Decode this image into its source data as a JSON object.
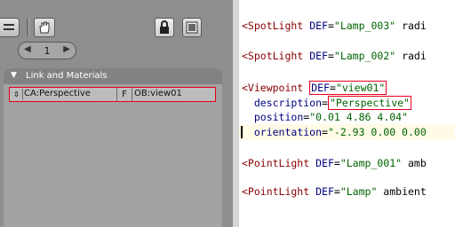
{
  "left_panel": {
    "frame_number": "1",
    "section_title": "Link and Materials",
    "row": {
      "camera_name": "CA:Perspective",
      "fake_user_label": "F",
      "object_name": "OB:view01"
    }
  },
  "code_lines": [
    {
      "tag": "<SpotLight",
      "attr": "DEF",
      "eq": "=",
      "val": "\"Lamp_003\"",
      "tail": " radi"
    },
    {
      "tag": "<SpotLight",
      "attr": "DEF",
      "eq": "=",
      "val": "\"Lamp_002\"",
      "tail": " radi"
    },
    {
      "tag": "<Viewpoint",
      "attr": "DEF",
      "eq": "=",
      "val": "\"view01\""
    },
    {
      "attr": "description",
      "eq": "=",
      "val": "\"Perspective\""
    },
    {
      "attr": "position",
      "eq": "=",
      "val": "\"0.01 4.86 4.04\""
    },
    {
      "attr": "orientation",
      "eq": "=",
      "val": "\"-2.93 0.00 0.00"
    },
    {
      "tag": "<PointLight",
      "attr": "DEF",
      "eq": "=",
      "val": "\"Lamp_001\"",
      "tail": " amb"
    },
    {
      "tag": "<PointLight",
      "attr": "DEF",
      "eq": "=",
      "val": "\"Lamp\"",
      "tail": " ambient"
    }
  ],
  "colors": {
    "highlight_box": "#e4001c",
    "tag": "#8b0000",
    "attr": "#000080",
    "value": "#006400"
  }
}
